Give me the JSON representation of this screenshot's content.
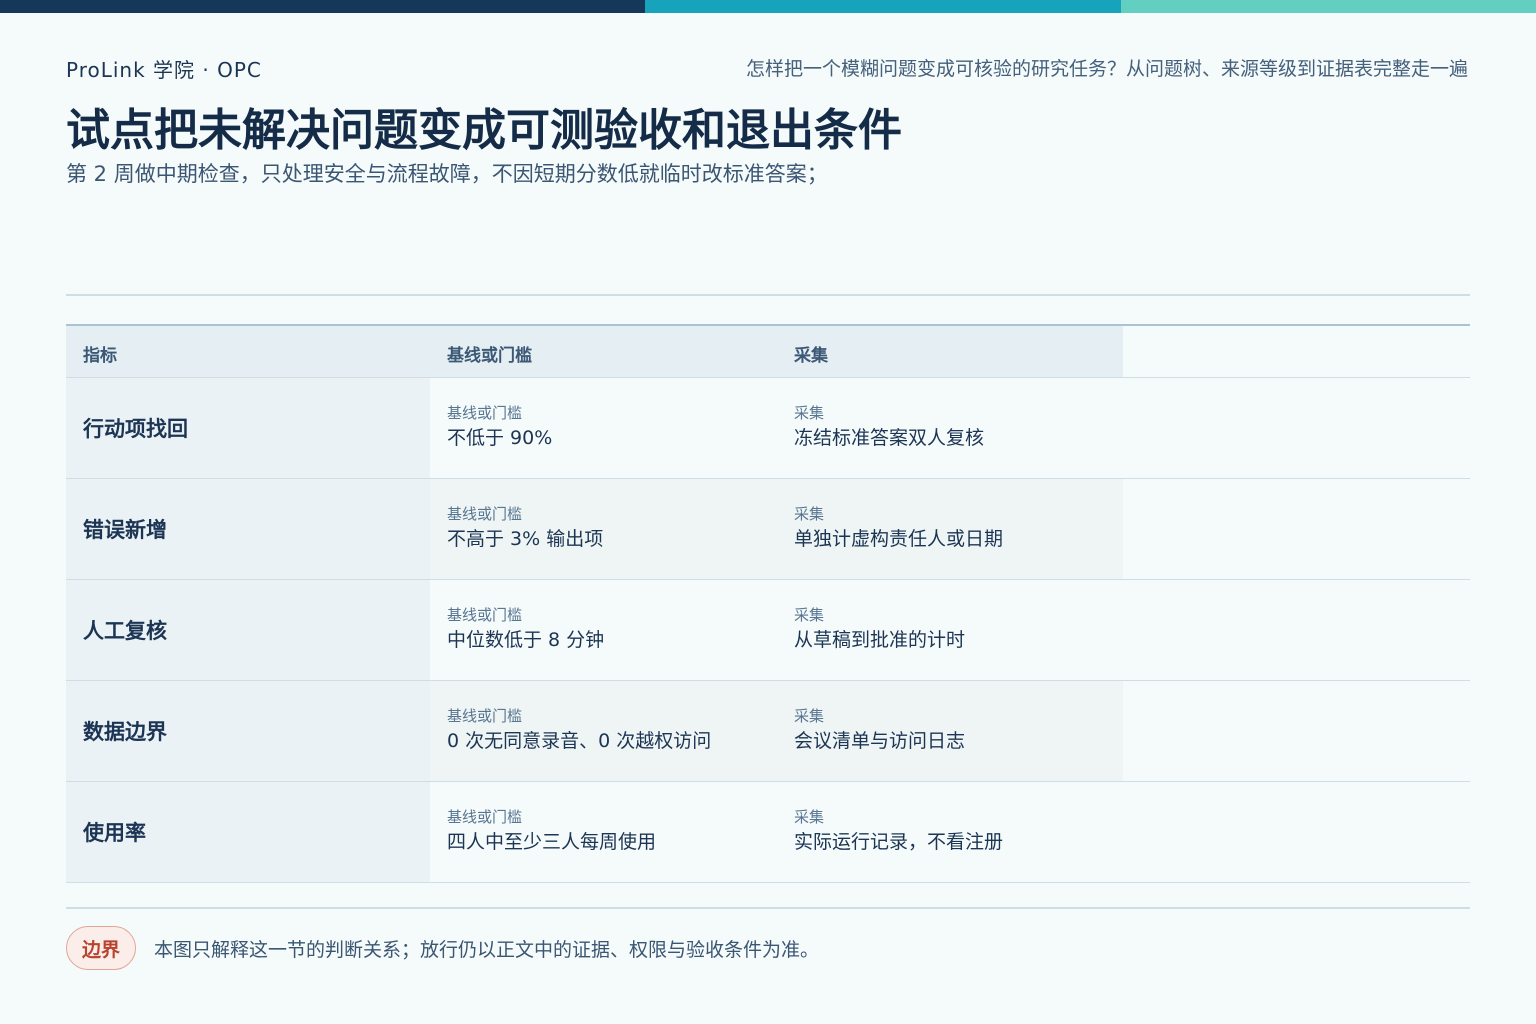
{
  "colors": {
    "topbar": [
      "#14375a",
      "#18a3bc",
      "#63cfc0"
    ],
    "accent": "#14375a",
    "boundary_badge": "#b8442f"
  },
  "header": {
    "brand": "ProLink 学院 · OPC",
    "tagline": "怎样把一个模糊问题变成可核验的研究任务？从问题树、来源等级到证据表完整走一遍",
    "title": "试点把未解决问题变成可测验收和退出条件",
    "subtitle": "第 2 周做中期检查，只处理安全与流程故障，不因短期分数低就临时改标准答案；"
  },
  "table": {
    "headers": [
      "指标",
      "基线或门槛",
      "采集"
    ],
    "rows": [
      {
        "metric": "行动项找回",
        "threshold_label": "基线或门槛",
        "threshold": "不低于 90%",
        "collect_label": "采集",
        "collect": "冻结标准答案双人复核"
      },
      {
        "metric": "错误新增",
        "threshold_label": "基线或门槛",
        "threshold": "不高于 3% 输出项",
        "collect_label": "采集",
        "collect": "单独计虚构责任人或日期"
      },
      {
        "metric": "人工复核",
        "threshold_label": "基线或门槛",
        "threshold": "中位数低于 8 分钟",
        "collect_label": "采集",
        "collect": "从草稿到批准的计时"
      },
      {
        "metric": "数据边界",
        "threshold_label": "基线或门槛",
        "threshold": "0 次无同意录音、0 次越权访问",
        "collect_label": "采集",
        "collect": "会议清单与访问日志"
      },
      {
        "metric": "使用率",
        "threshold_label": "基线或门槛",
        "threshold": "四人中至少三人每周使用",
        "collect_label": "采集",
        "collect": "实际运行记录，不看注册"
      }
    ]
  },
  "footer": {
    "badge": "边界",
    "note": "本图只解释这一节的判断关系；放行仍以正文中的证据、权限与验收条件为准。"
  }
}
